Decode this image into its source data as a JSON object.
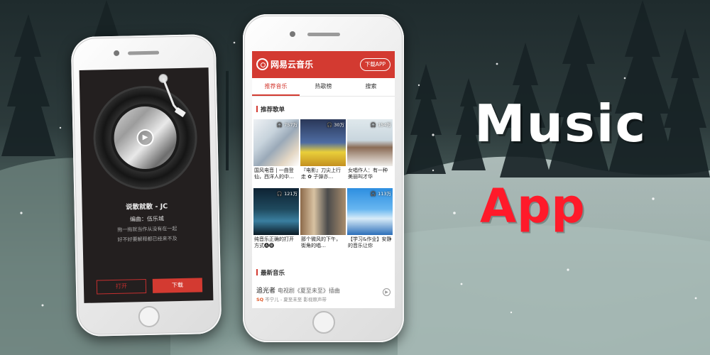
{
  "brand": {
    "accent": "#d33a31",
    "title_primary": "Music",
    "title_secondary": "App"
  },
  "left_player": {
    "song_title": "说散就散 - JC",
    "editor": "编曲：伍乐城",
    "lyrics": [
      "拖一拖就当作从没有在一起",
      "好不好要解释都已经来不及"
    ],
    "btn_open": "打开",
    "btn_download": "下载"
  },
  "right_app": {
    "app_name": "网易云音乐",
    "download_app": "下载APP",
    "tabs": [
      {
        "label": "推荐音乐",
        "active": true
      },
      {
        "label": "热歌榜",
        "active": false
      },
      {
        "label": "搜索",
        "active": false
      }
    ],
    "section_playlists": "推荐歌单",
    "playlists": [
      {
        "count": "757万",
        "caption": "国风电音 | 一曲登仙，西洋人的中…"
      },
      {
        "count": "30万",
        "caption": "『电影』刀尖上行走 ✿ 子弹亦…"
      },
      {
        "count": "154万",
        "caption": "女唱作人：有一种美丽叫才华"
      },
      {
        "count": "121万",
        "caption": "纯音乐正确的打开方式🅐🅑"
      },
      {
        "count": "",
        "caption": "那个微风的下午，街角的唱…"
      },
      {
        "count": "113万",
        "caption": "【学习&作业】安静的音乐让你"
      }
    ],
    "section_new": "最新音乐",
    "new_song": {
      "title": "追光者",
      "subtitle": "电视剧《夏至未至》插曲",
      "artist": "岑宁儿 - 夏至未至 影视原声带",
      "quality": "SQ"
    }
  }
}
